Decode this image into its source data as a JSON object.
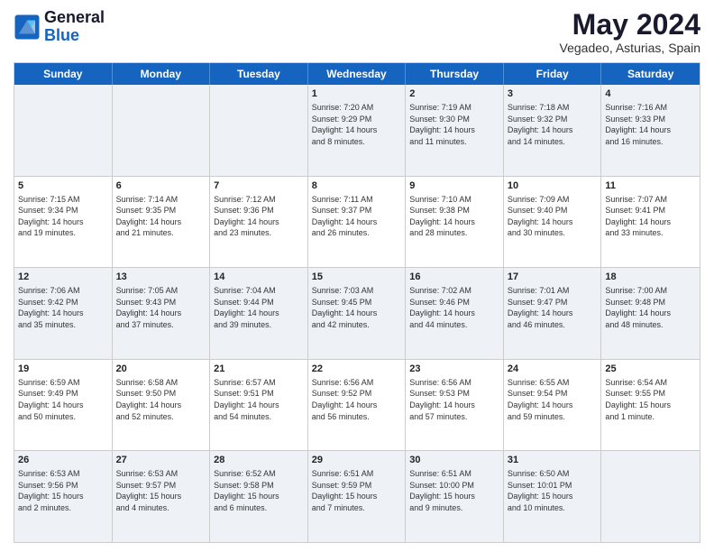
{
  "logo": {
    "line1": "General",
    "line2": "Blue"
  },
  "title": {
    "month_year": "May 2024",
    "location": "Vegadeo, Asturias, Spain"
  },
  "weekdays": [
    "Sunday",
    "Monday",
    "Tuesday",
    "Wednesday",
    "Thursday",
    "Friday",
    "Saturday"
  ],
  "rows": [
    [
      {
        "day": "",
        "info": ""
      },
      {
        "day": "",
        "info": ""
      },
      {
        "day": "",
        "info": ""
      },
      {
        "day": "1",
        "info": "Sunrise: 7:20 AM\nSunset: 9:29 PM\nDaylight: 14 hours\nand 8 minutes."
      },
      {
        "day": "2",
        "info": "Sunrise: 7:19 AM\nSunset: 9:30 PM\nDaylight: 14 hours\nand 11 minutes."
      },
      {
        "day": "3",
        "info": "Sunrise: 7:18 AM\nSunset: 9:32 PM\nDaylight: 14 hours\nand 14 minutes."
      },
      {
        "day": "4",
        "info": "Sunrise: 7:16 AM\nSunset: 9:33 PM\nDaylight: 14 hours\nand 16 minutes."
      }
    ],
    [
      {
        "day": "5",
        "info": "Sunrise: 7:15 AM\nSunset: 9:34 PM\nDaylight: 14 hours\nand 19 minutes."
      },
      {
        "day": "6",
        "info": "Sunrise: 7:14 AM\nSunset: 9:35 PM\nDaylight: 14 hours\nand 21 minutes."
      },
      {
        "day": "7",
        "info": "Sunrise: 7:12 AM\nSunset: 9:36 PM\nDaylight: 14 hours\nand 23 minutes."
      },
      {
        "day": "8",
        "info": "Sunrise: 7:11 AM\nSunset: 9:37 PM\nDaylight: 14 hours\nand 26 minutes."
      },
      {
        "day": "9",
        "info": "Sunrise: 7:10 AM\nSunset: 9:38 PM\nDaylight: 14 hours\nand 28 minutes."
      },
      {
        "day": "10",
        "info": "Sunrise: 7:09 AM\nSunset: 9:40 PM\nDaylight: 14 hours\nand 30 minutes."
      },
      {
        "day": "11",
        "info": "Sunrise: 7:07 AM\nSunset: 9:41 PM\nDaylight: 14 hours\nand 33 minutes."
      }
    ],
    [
      {
        "day": "12",
        "info": "Sunrise: 7:06 AM\nSunset: 9:42 PM\nDaylight: 14 hours\nand 35 minutes."
      },
      {
        "day": "13",
        "info": "Sunrise: 7:05 AM\nSunset: 9:43 PM\nDaylight: 14 hours\nand 37 minutes."
      },
      {
        "day": "14",
        "info": "Sunrise: 7:04 AM\nSunset: 9:44 PM\nDaylight: 14 hours\nand 39 minutes."
      },
      {
        "day": "15",
        "info": "Sunrise: 7:03 AM\nSunset: 9:45 PM\nDaylight: 14 hours\nand 42 minutes."
      },
      {
        "day": "16",
        "info": "Sunrise: 7:02 AM\nSunset: 9:46 PM\nDaylight: 14 hours\nand 44 minutes."
      },
      {
        "day": "17",
        "info": "Sunrise: 7:01 AM\nSunset: 9:47 PM\nDaylight: 14 hours\nand 46 minutes."
      },
      {
        "day": "18",
        "info": "Sunrise: 7:00 AM\nSunset: 9:48 PM\nDaylight: 14 hours\nand 48 minutes."
      }
    ],
    [
      {
        "day": "19",
        "info": "Sunrise: 6:59 AM\nSunset: 9:49 PM\nDaylight: 14 hours\nand 50 minutes."
      },
      {
        "day": "20",
        "info": "Sunrise: 6:58 AM\nSunset: 9:50 PM\nDaylight: 14 hours\nand 52 minutes."
      },
      {
        "day": "21",
        "info": "Sunrise: 6:57 AM\nSunset: 9:51 PM\nDaylight: 14 hours\nand 54 minutes."
      },
      {
        "day": "22",
        "info": "Sunrise: 6:56 AM\nSunset: 9:52 PM\nDaylight: 14 hours\nand 56 minutes."
      },
      {
        "day": "23",
        "info": "Sunrise: 6:56 AM\nSunset: 9:53 PM\nDaylight: 14 hours\nand 57 minutes."
      },
      {
        "day": "24",
        "info": "Sunrise: 6:55 AM\nSunset: 9:54 PM\nDaylight: 14 hours\nand 59 minutes."
      },
      {
        "day": "25",
        "info": "Sunrise: 6:54 AM\nSunset: 9:55 PM\nDaylight: 15 hours\nand 1 minute."
      }
    ],
    [
      {
        "day": "26",
        "info": "Sunrise: 6:53 AM\nSunset: 9:56 PM\nDaylight: 15 hours\nand 2 minutes."
      },
      {
        "day": "27",
        "info": "Sunrise: 6:53 AM\nSunset: 9:57 PM\nDaylight: 15 hours\nand 4 minutes."
      },
      {
        "day": "28",
        "info": "Sunrise: 6:52 AM\nSunset: 9:58 PM\nDaylight: 15 hours\nand 6 minutes."
      },
      {
        "day": "29",
        "info": "Sunrise: 6:51 AM\nSunset: 9:59 PM\nDaylight: 15 hours\nand 7 minutes."
      },
      {
        "day": "30",
        "info": "Sunrise: 6:51 AM\nSunset: 10:00 PM\nDaylight: 15 hours\nand 9 minutes."
      },
      {
        "day": "31",
        "info": "Sunrise: 6:50 AM\nSunset: 10:01 PM\nDaylight: 15 hours\nand 10 minutes."
      },
      {
        "day": "",
        "info": ""
      }
    ]
  ],
  "alt_rows": [
    0,
    2,
    4
  ]
}
